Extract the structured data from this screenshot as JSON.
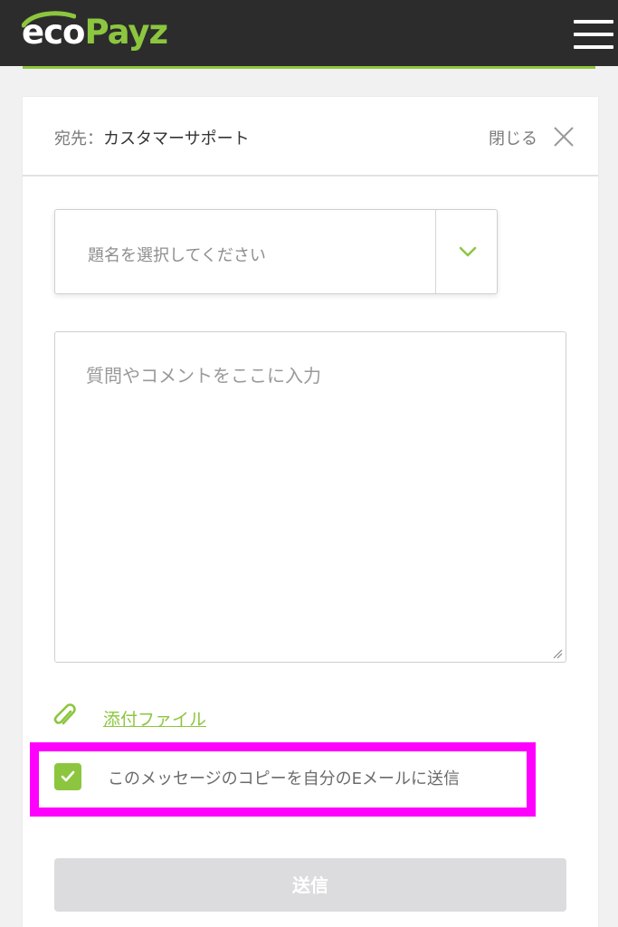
{
  "header": {
    "logo_eco": "eco",
    "logo_payz": "Payz",
    "menu_icon": "hamburger-menu-icon"
  },
  "dialog": {
    "to_prefix": "宛先：",
    "to_value": "カスタマーサポート",
    "close_label": "閉じる",
    "close_icon": "close-icon"
  },
  "form": {
    "subject_placeholder": "題名を選択してください",
    "subject_icon": "chevron-down-icon",
    "message_placeholder": "質問やコメントをここに入力",
    "attach_label": "添付ファイル",
    "attach_icon": "paperclip-icon",
    "copy_checkbox_checked": true,
    "copy_label": "このメッセージのコピーを自分のEメールに送信",
    "submit_label": "送信"
  },
  "colors": {
    "brand_green": "#8cc63f",
    "topbar": "#2c2c2c",
    "highlight": "#ff00ff",
    "submit_disabled": "#dcdcdf"
  }
}
